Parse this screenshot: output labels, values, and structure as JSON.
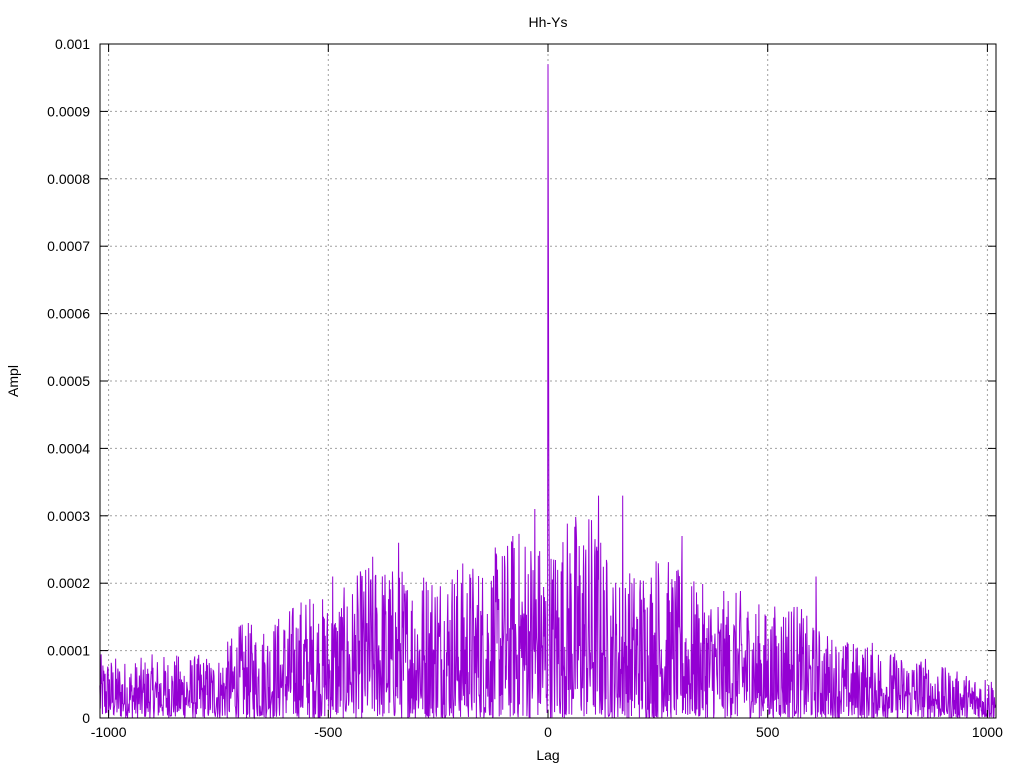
{
  "chart_data": {
    "type": "line",
    "title": "Hh-Ys",
    "xlabel": "Lag",
    "ylabel": "Ampl",
    "xlim": [
      -1020,
      1018
    ],
    "ylim": [
      0,
      0.001
    ],
    "x_ticks": [
      "-1000",
      "-500",
      "0",
      "500",
      "1000"
    ],
    "x_tick_values": [
      -1000,
      -500,
      0,
      500,
      1000
    ],
    "y_ticks": [
      "0",
      "0.0001",
      "0.0002",
      "0.0003",
      "0.0004",
      "0.0005",
      "0.0006",
      "0.0007",
      "0.0008",
      "0.0009",
      "0.001"
    ],
    "y_tick_values": [
      0,
      0.0001,
      0.0002,
      0.0003,
      0.0004,
      0.0005,
      0.0006,
      0.0007,
      0.0008,
      0.0009,
      0.001
    ],
    "grid": true,
    "series": [
      {
        "name": "Hh-Ys",
        "color": "#9400d3",
        "lag_range": [
          -1020,
          1018
        ],
        "envelope_step": 50,
        "envelope_start": -1000,
        "envelope_max": [
          0.0001,
          9e-05,
          0.0001,
          0.0001,
          0.0001,
          0.0001,
          0.00015,
          0.00015,
          0.00017,
          0.0002,
          0.00019,
          0.00021,
          0.00026,
          0.00024,
          0.00024,
          0.00025,
          0.00025,
          0.00025,
          0.00028,
          0.00031,
          0.00027,
          0.00033,
          0.00033,
          0.00023,
          0.00024,
          0.00027,
          0.00023,
          0.00021,
          0.0002,
          0.0002,
          0.00017,
          0.0002,
          0.00015,
          0.00013,
          0.00012,
          0.00012,
          0.0001,
          0.0001,
          8e-05,
          7e-05,
          7e-05
        ],
        "peaks": [
          [
            0,
            0.00097
          ],
          [
            1,
            0.00066
          ],
          [
            2,
            0.00032
          ],
          [
            115,
            0.00033
          ],
          [
            170,
            0.00033
          ],
          [
            -30,
            0.00031
          ],
          [
            -80,
            0.00027
          ],
          [
            -340,
            0.00026
          ],
          [
            305,
            0.00027
          ],
          [
            610,
            0.00021
          ],
          [
            -490,
            0.00021
          ]
        ]
      }
    ]
  }
}
